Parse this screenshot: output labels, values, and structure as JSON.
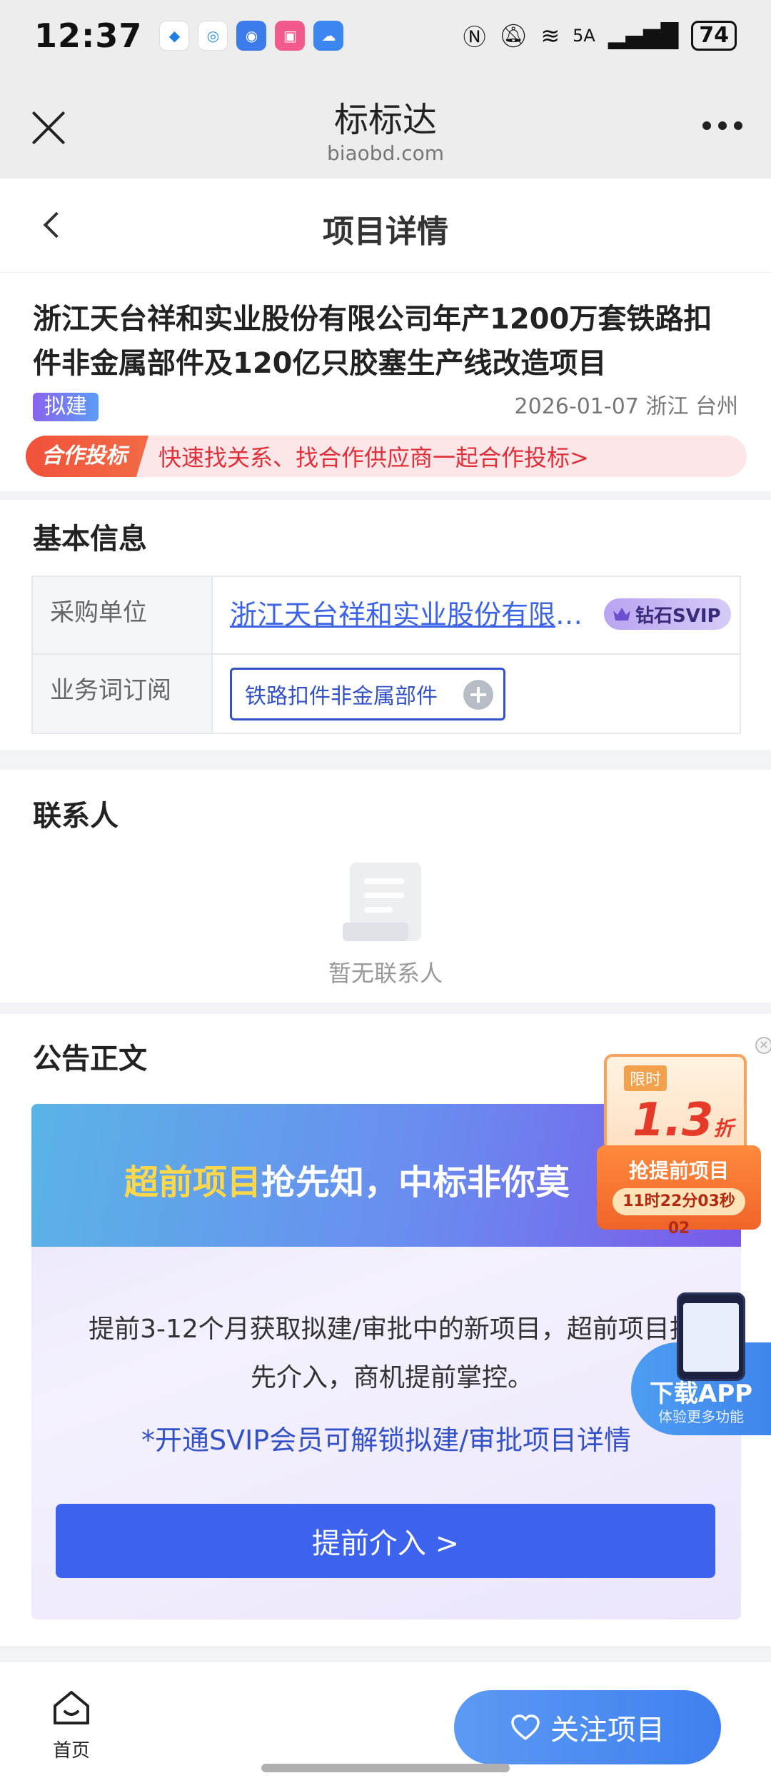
{
  "status_bar": {
    "time": "12:37",
    "battery": "74",
    "network": "5A"
  },
  "browser": {
    "title": "标标达",
    "url": "biaobd.com"
  },
  "page": {
    "title": "项目详情"
  },
  "project": {
    "title": "浙江天台祥和实业股份有限公司年产1200万套铁路扣件非金属部件及120亿只胶塞生产线改造项目",
    "status_tag": "拟建",
    "date": "2026-01-07",
    "location": "浙江 台州",
    "coop_badge": "合作投标",
    "coop_text": "快速找关系、找合作供应商一起合作投标>"
  },
  "basic_info": {
    "title": "基本信息",
    "buyer_label": "采购单位",
    "buyer_value": "浙江天台祥和实业股份有限公司",
    "svip_label": "钻石SVIP",
    "subscribe_label": "业务词订阅",
    "subscribe_value": "铁路扣件非金属部件"
  },
  "contact": {
    "title": "联系人",
    "empty_text": "暂无联系人"
  },
  "announcement": {
    "title": "公告正文",
    "headline_highlight": "超前项目",
    "headline_rest": "抢先知，中标非你莫",
    "body": "提前3-12个月获取拟建/审批中的新项目，超前项目抢先介入，商机提前掌控。",
    "note": "*开通SVIP会员可解锁拟建/审批项目详情",
    "cta": "提前介入 >"
  },
  "float_promo": {
    "tag": "限时",
    "discount": "1.3",
    "discount_unit": "折",
    "button": "抢提前项目",
    "timer": "11时22分03秒02"
  },
  "download": {
    "title": "下载APP",
    "subtitle": "体验更多功能"
  },
  "bottom_nav": {
    "home_label": "首页",
    "follow_label": "关注项目"
  },
  "colors": {
    "accent": "#3d63ee",
    "link": "#3d64e6",
    "coop_red": "#e0303a"
  }
}
